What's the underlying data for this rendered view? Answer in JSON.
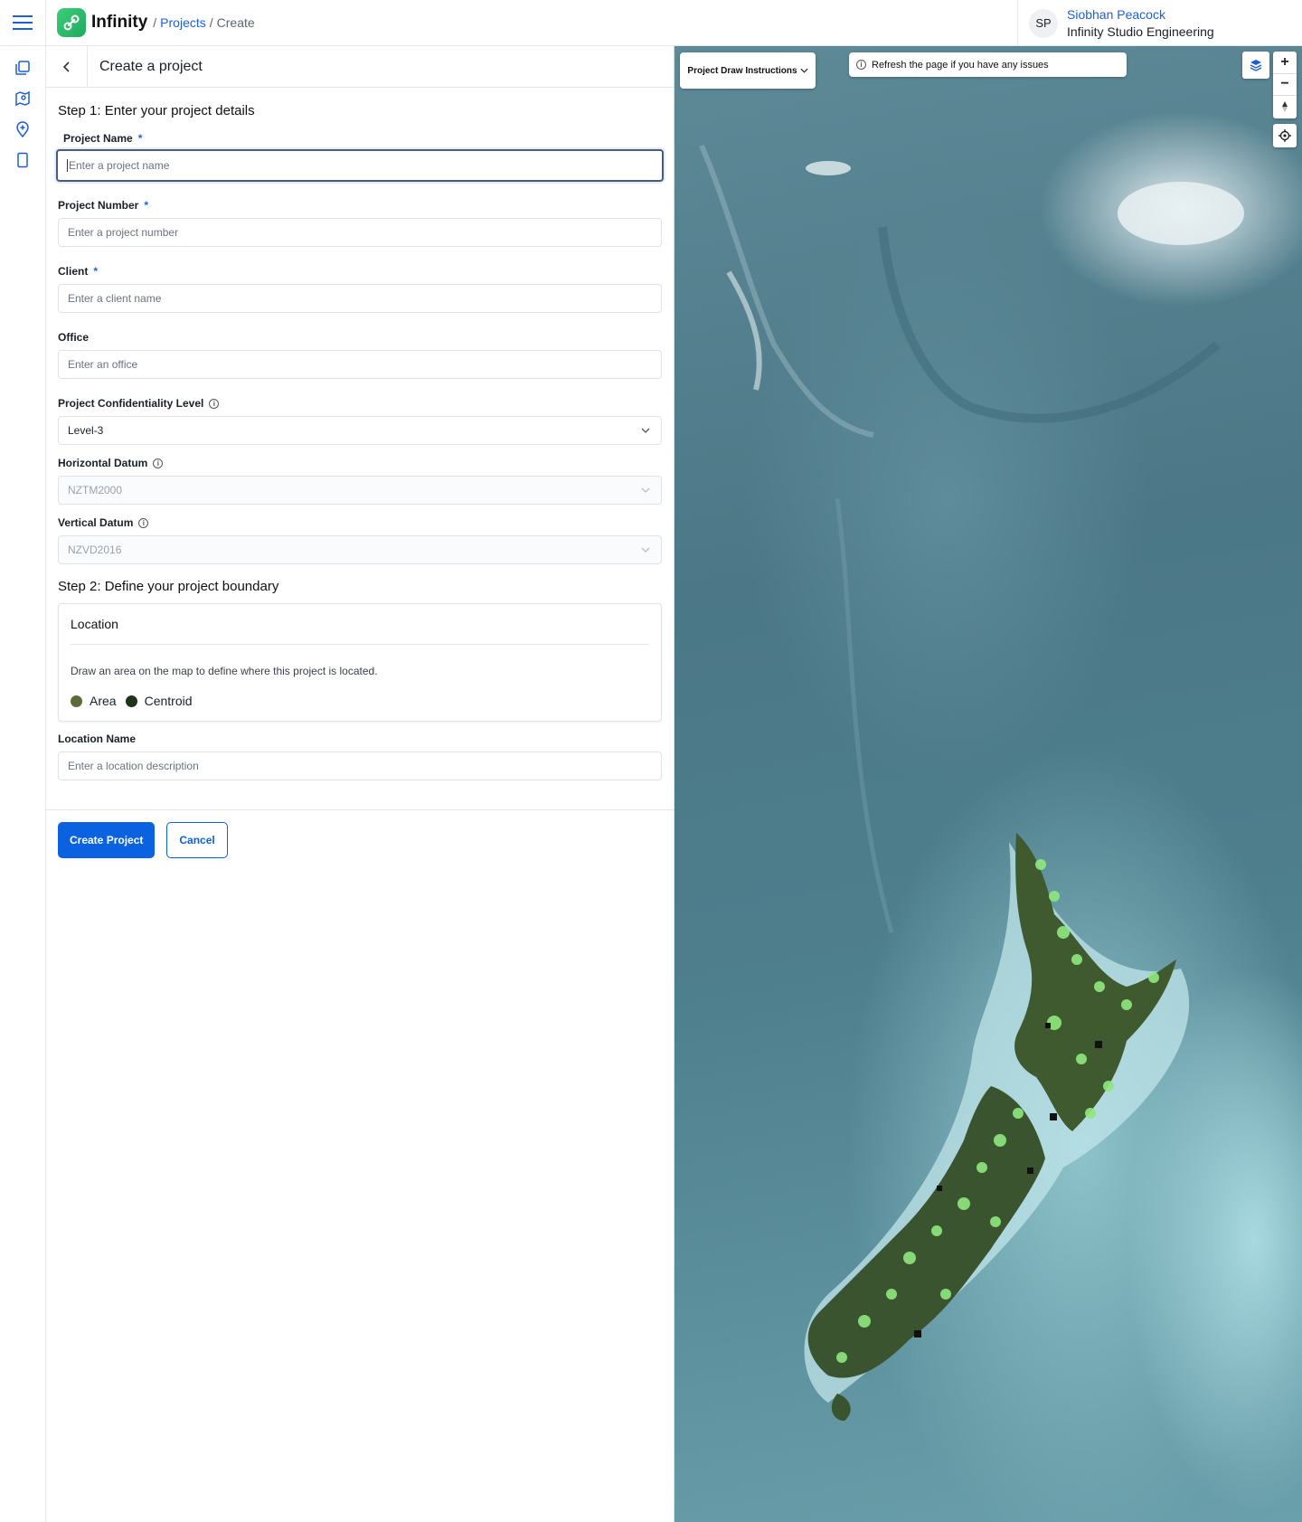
{
  "header": {
    "app_title": "Infinity",
    "breadcrumb": {
      "projects": "Projects",
      "current": "Create",
      "sep": "/"
    },
    "user": {
      "initials": "SP",
      "name": "Siobhan Peacock",
      "org": "Infinity Studio Engineering"
    }
  },
  "rail": {
    "icons": [
      "projects-icon",
      "map-icon",
      "add-location-icon",
      "tablet-icon"
    ]
  },
  "panel": {
    "title": "Create a project",
    "step1": "Step 1: Enter your project details",
    "fields": {
      "project_name": {
        "label": "Project Name",
        "req": "*",
        "placeholder": "Enter a project name"
      },
      "project_number": {
        "label": "Project Number",
        "req": "*",
        "placeholder": "Enter a project number"
      },
      "client": {
        "label": "Client",
        "req": "*",
        "placeholder": "Enter a client name"
      },
      "office": {
        "label": "Office",
        "placeholder": "Enter an office"
      },
      "confidentiality": {
        "label": "Project Confidentiality Level",
        "value": "Level-3"
      },
      "horizontal_datum": {
        "label": "Horizontal Datum",
        "value": "NZTM2000"
      },
      "vertical_datum": {
        "label": "Vertical Datum",
        "value": "NZVD2016"
      },
      "location_name": {
        "label": "Location Name",
        "placeholder": "Enter a location description"
      }
    },
    "step2": "Step 2: Define your project boundary",
    "location_card": {
      "title": "Location",
      "description": "Draw an area on the map to define where this project is located.",
      "legend": [
        {
          "label": "Area",
          "color": "#5c6b3a"
        },
        {
          "label": "Centroid",
          "color": "#1f3318"
        }
      ]
    },
    "actions": {
      "create": "Create Project",
      "cancel": "Cancel"
    }
  },
  "map": {
    "instructions": "Project Draw Instructions",
    "notice": "Refresh the page if you have any issues",
    "zoom_in": "+",
    "zoom_out": "−"
  }
}
